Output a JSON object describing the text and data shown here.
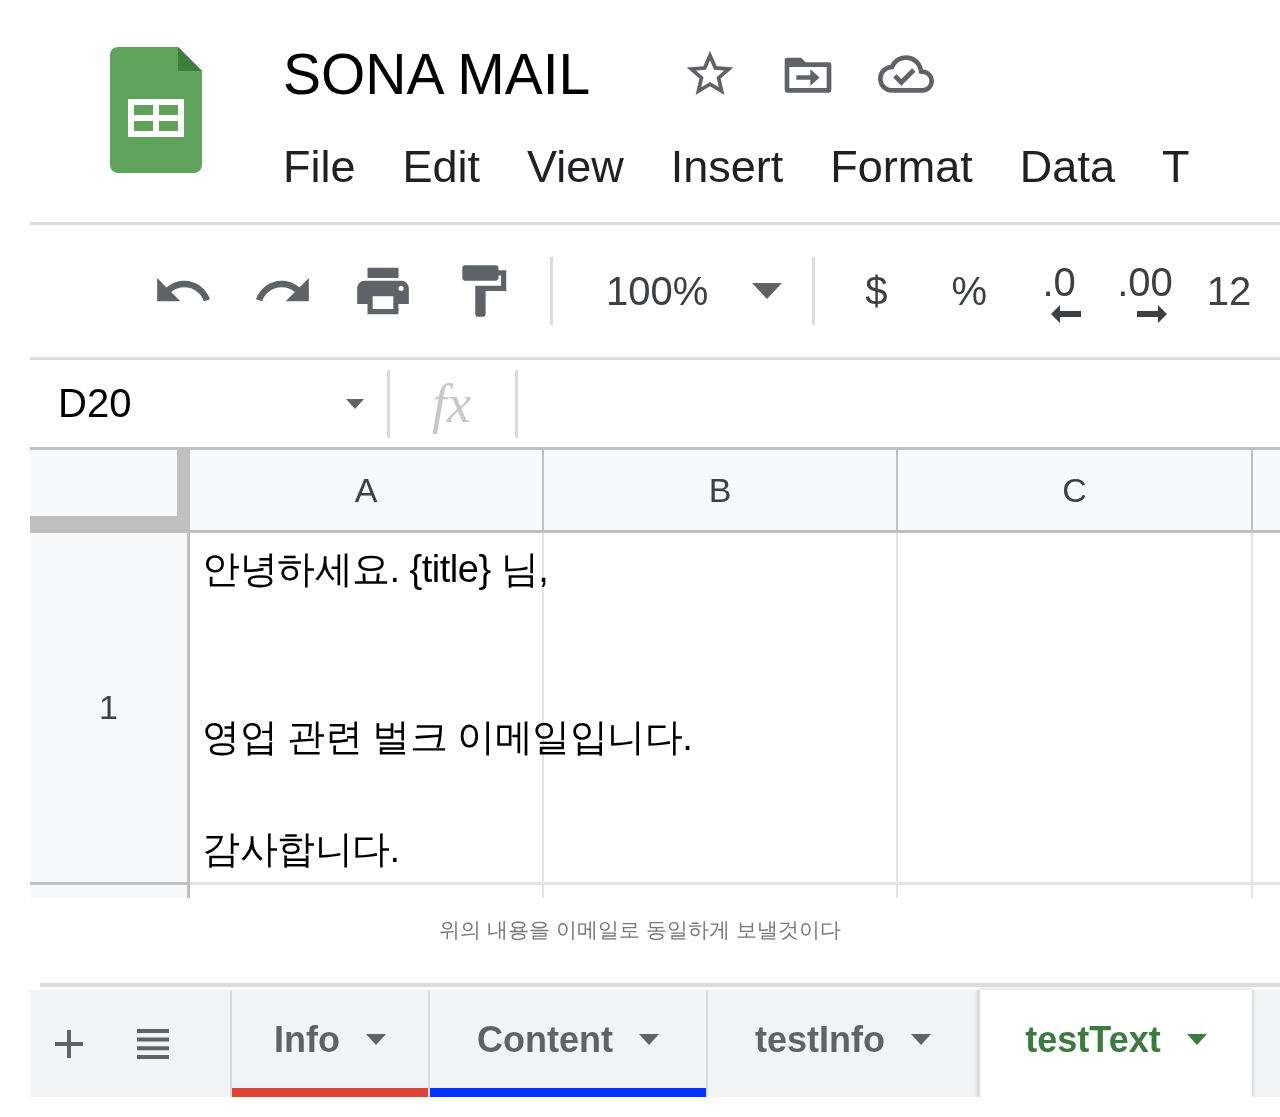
{
  "document": {
    "title": "SONA MAIL"
  },
  "menu": [
    "File",
    "Edit",
    "View",
    "Insert",
    "Format",
    "Data",
    "T"
  ],
  "toolbar": {
    "zoom": "100%",
    "currency": "$",
    "percent": "%",
    "decrease_decimals": ".0",
    "increase_decimals": ".00",
    "more_formats": "12"
  },
  "formula_bar": {
    "cell_reference": "D20",
    "function_label": "fx"
  },
  "grid": {
    "columns": [
      "A",
      "B",
      "C"
    ],
    "rows": [
      {
        "header": "1",
        "column_a": "안녕하세요. {title} 님,\n\n\n영업 관련 벌크 이메일입니다.\n\n감사합니다."
      }
    ]
  },
  "caption": "위의 내용을 이메일로 동일하게 보낼것이다",
  "sheet_tabs": [
    {
      "label": "Info",
      "selected": false,
      "color": "#db4437"
    },
    {
      "label": "Content",
      "selected": false,
      "color": "#0433ff"
    },
    {
      "label": "testInfo",
      "selected": false
    },
    {
      "label": "testText",
      "selected": true
    }
  ]
}
